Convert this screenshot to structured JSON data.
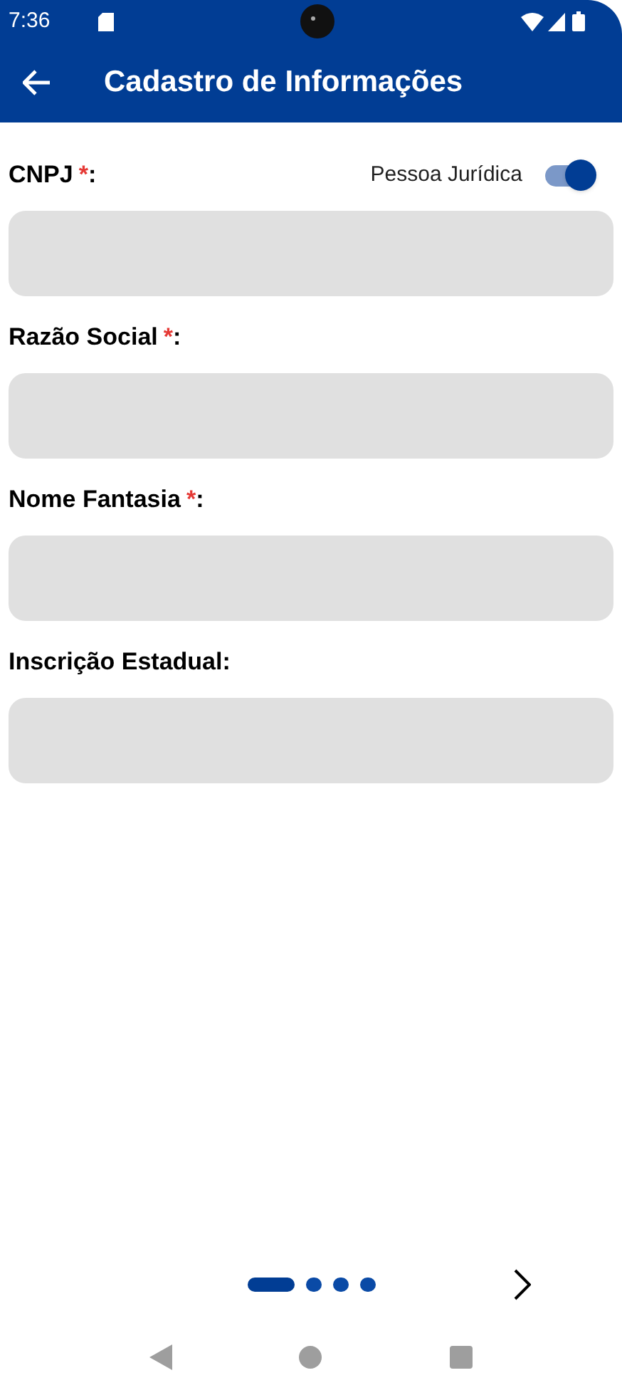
{
  "status_bar": {
    "time": "7:36"
  },
  "app_bar": {
    "title": "Cadastro de Informações"
  },
  "toggle": {
    "label": "Pessoa Jurídica",
    "on": true
  },
  "fields": [
    {
      "label": "CNPJ",
      "required": true,
      "marker": "*",
      "suffix": ":"
    },
    {
      "label": "Razão Social",
      "required": true,
      "marker": "*",
      "suffix": ":"
    },
    {
      "label": "Nome Fantasia",
      "required": true,
      "marker": "*",
      "suffix": ":"
    },
    {
      "label": "Inscrição Estadual",
      "required": false,
      "suffix": ":"
    }
  ],
  "pager": [
    {
      "selected": true
    },
    {
      "selected": false
    },
    {
      "selected": false
    },
    {
      "selected": false
    }
  ]
}
